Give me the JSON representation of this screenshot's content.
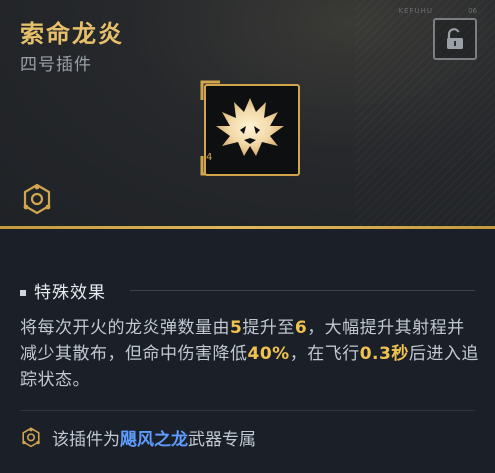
{
  "plugin": {
    "name": "索命龙炎",
    "type": "四号插件",
    "tiny_code": "KEFUHU",
    "tiny_num": "06",
    "slot_number": "4"
  },
  "effect": {
    "section_title": "特殊效果",
    "desc_part1": "将每次开火的龙炎弹数量由",
    "val_from": "5",
    "desc_part2": "提升至",
    "val_to": "6",
    "desc_part3": "，大幅提升其射程并减少其散布，但命中伤害降低",
    "val_penalty": "40%",
    "desc_part4": "，在飞行",
    "val_time": "0.3秒",
    "desc_part5": "后进入追踪状态。"
  },
  "exclusive": {
    "prefix": "该插件为",
    "weapon": "飓风之龙",
    "suffix": "武器专属"
  },
  "colors": {
    "accent_gold": "#e7c06a",
    "highlight_yellow": "#f0c350",
    "weapon_blue": "#5f9cff"
  },
  "icons": {
    "lock": "unlock-icon",
    "plugin": "dragon-flame-icon",
    "exclusive": "exclusive-weapon-icon"
  }
}
